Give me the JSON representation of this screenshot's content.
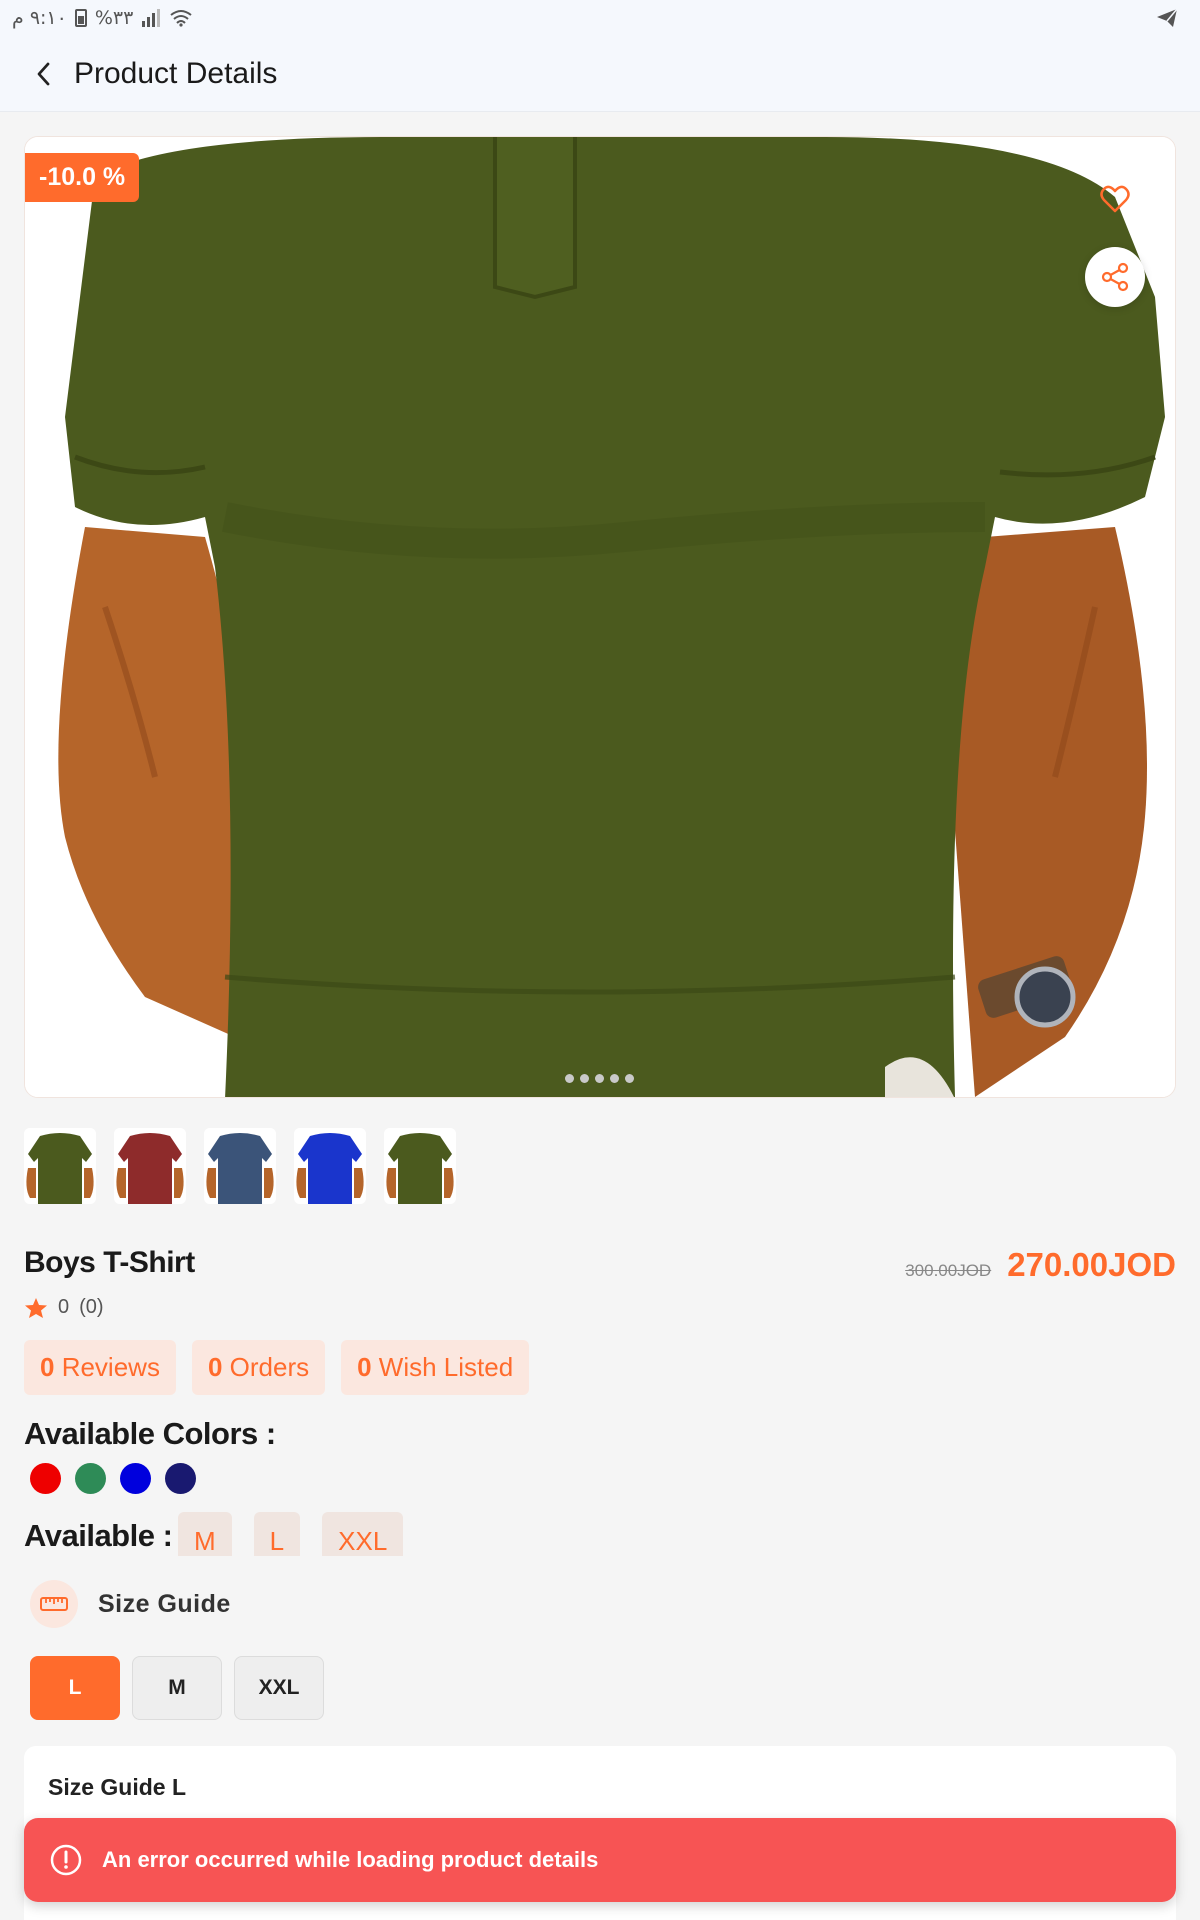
{
  "status_bar": {
    "time": "٩:١٠ م",
    "battery": "%٣٣",
    "signal_icon": "signal-bars-icon",
    "wifi_icon": "wifi-icon",
    "send_icon": "telegram-send-icon"
  },
  "header": {
    "title": "Product Details",
    "back_icon": "chevron-left-icon"
  },
  "hero": {
    "discount": "-10.0 %",
    "favorite_icon": "heart-icon",
    "share_icon": "share-icon",
    "page_dots": 5
  },
  "thumbnails": [
    {
      "color": "#4b5a1e"
    },
    {
      "color": "#8e2b2b"
    },
    {
      "color": "#3b5479"
    },
    {
      "color": "#1a35cc"
    },
    {
      "color": "#4b5a1e"
    }
  ],
  "product": {
    "name": "Boys T-Shirt",
    "old_price": "300.00JOD",
    "price": "270.00JOD",
    "rating": "0",
    "rating_count": "(0)"
  },
  "stats": [
    {
      "count": "0",
      "label": " Reviews"
    },
    {
      "count": "0",
      "label": " Orders"
    },
    {
      "count": "0",
      "label": " Wish Listed"
    }
  ],
  "colors": {
    "title": "Available Colors :",
    "items": [
      "#ee0000",
      "#2e8b57",
      "#0000dd",
      "#191970"
    ]
  },
  "available_sizes": {
    "title": "Available :",
    "items": [
      "M",
      "L",
      "XXL"
    ]
  },
  "size_guide": {
    "label": "Size Guide",
    "options": [
      "L",
      "M",
      "XXL"
    ],
    "selected": "L",
    "card_title": "Size Guide L"
  },
  "error": {
    "message": "An error occurred while loading product details"
  },
  "theme": {
    "accent": "#ff6b2c",
    "error": "#f75454"
  }
}
